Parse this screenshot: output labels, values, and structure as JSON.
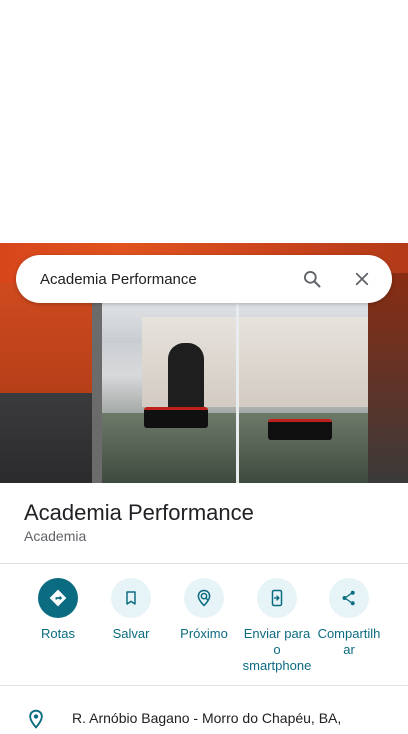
{
  "search": {
    "query": "Academia Performance",
    "search_icon": "search-icon",
    "close_icon": "close-icon"
  },
  "place": {
    "name": "Academia Performance",
    "category": "Academia",
    "photo_icon": "storefront-photo"
  },
  "actions": [
    {
      "label": "Rotas",
      "icon": "directions-icon"
    },
    {
      "label": "Salvar",
      "icon": "bookmark-icon"
    },
    {
      "label": "Próximo",
      "icon": "nearby-icon"
    },
    {
      "label": "Enviar para o smartphone",
      "icon": "send-to-phone-icon"
    },
    {
      "label": "Compartilhar",
      "icon": "share-icon"
    }
  ],
  "address": {
    "text": "R. Arnóbio Bagano - Morro do Chapéu, BA,",
    "icon": "location-pin-icon"
  },
  "colors": {
    "accent": "#0b6b80",
    "accent_light": "#e6f4f7",
    "text": "#202124",
    "secondary_text": "#5f6368"
  }
}
